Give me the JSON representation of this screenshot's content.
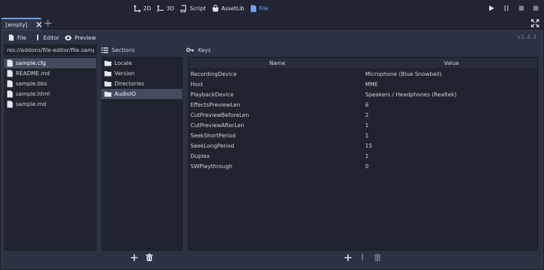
{
  "workspaces": [
    {
      "label": "2D"
    },
    {
      "label": "3D"
    },
    {
      "label": "Script"
    },
    {
      "label": "AssetLib"
    },
    {
      "label": "File"
    }
  ],
  "scene_tab": {
    "label": "[empty]"
  },
  "toolbar": {
    "file_label": "File",
    "editor_label": "Editor",
    "preview_label": "Preview",
    "version": "v1.4.3"
  },
  "file_browser": {
    "path": "res://addons/file-editor/file.sampl",
    "files": [
      "sample.cfg",
      "README.md",
      "sample.bbs",
      "sample.html",
      "sample.md"
    ]
  },
  "sections": {
    "title": "Sections",
    "items": [
      "Locale",
      "Version",
      "Directories",
      "AudioIO"
    ]
  },
  "keys": {
    "title": "Keys",
    "columns": {
      "name": "Name",
      "value": "Value"
    },
    "rows": [
      {
        "name": "RecordingDevice",
        "value": "Microphone (Blue Snowball)"
      },
      {
        "name": "Host",
        "value": "MME"
      },
      {
        "name": "PlaybackDevice",
        "value": "Speakers / Headphones (Realtek)"
      },
      {
        "name": "EffectsPreviewLen",
        "value": "6"
      },
      {
        "name": "CutPreviewBeforeLen",
        "value": "2"
      },
      {
        "name": "CutPreviewAfterLen",
        "value": "1"
      },
      {
        "name": "SeekShortPeriod",
        "value": "1"
      },
      {
        "name": "SeekLongPeriod",
        "value": "15"
      },
      {
        "name": "Duplex",
        "value": "1"
      },
      {
        "name": "SWPlaythrough",
        "value": "0"
      }
    ]
  },
  "colors": {
    "accent": "#6ea2ff",
    "panel_bg": "#1e232d",
    "window_bg": "#2b3242",
    "selected_row": "#434b5d"
  }
}
